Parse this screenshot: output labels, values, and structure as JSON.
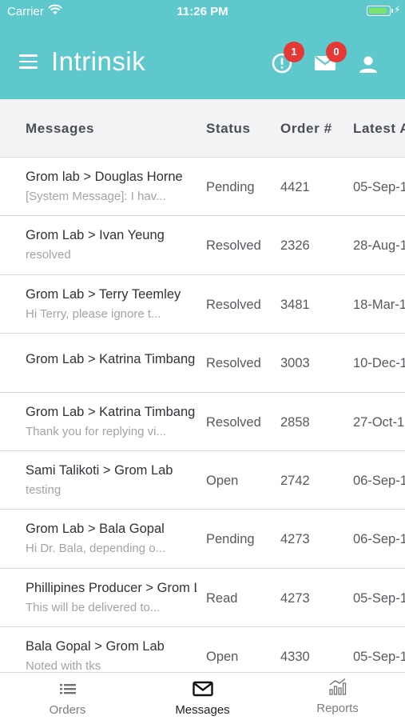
{
  "status_bar": {
    "carrier": "Carrier",
    "time": "11:26 PM"
  },
  "header": {
    "title": "Intrinsik",
    "alerts_badge": "1",
    "mail_badge": "0"
  },
  "table": {
    "columns": [
      "Messages",
      "Status",
      "Order #",
      "Latest Activity"
    ],
    "rows": [
      {
        "title": "Grom lab > Douglas Horne",
        "preview": "[System Message]: I hav...",
        "status": "Pending",
        "order": "4421",
        "date": "05-Sep-1"
      },
      {
        "title": "Grom Lab > Ivan Yeung",
        "preview": "resolved",
        "status": "Resolved",
        "order": "2326",
        "date": "28-Aug-1"
      },
      {
        "title": "Grom Lab > Terry Teemley",
        "preview": "Hi Terry, please ignore t...",
        "status": "Resolved",
        "order": "3481",
        "date": "18-Mar-1"
      },
      {
        "title": "Grom Lab > Katrina Timbang",
        "preview": "",
        "status": "Resolved",
        "order": "3003",
        "date": "10-Dec-1"
      },
      {
        "title": "Grom Lab > Katrina Timbang",
        "preview": "Thank you for replying vi...",
        "status": "Resolved",
        "order": "2858",
        "date": "27-Oct-1"
      },
      {
        "title": "Sami Talikoti > Grom Lab",
        "preview": "testing",
        "status": "Open",
        "order": "2742",
        "date": "06-Sep-1"
      },
      {
        "title": "Grom Lab > Bala Gopal",
        "preview": "Hi Dr. Bala, depending o...",
        "status": "Pending",
        "order": "4273",
        "date": "06-Sep-1"
      },
      {
        "title": "Phillipines Producer > Grom Lab",
        "preview": "This will be delivered to...",
        "status": "Read",
        "order": "4273",
        "date": "05-Sep-1"
      },
      {
        "title": "Bala Gopal > Grom Lab",
        "preview": "Noted with tks",
        "status": "Open",
        "order": "4330",
        "date": "05-Sep-1"
      }
    ]
  },
  "tabbar": {
    "orders": "Orders",
    "messages": "Messages",
    "reports": "Reports",
    "active": "messages"
  },
  "colors": {
    "header_bg": "#5ec8cc",
    "badge": "#e53935"
  }
}
